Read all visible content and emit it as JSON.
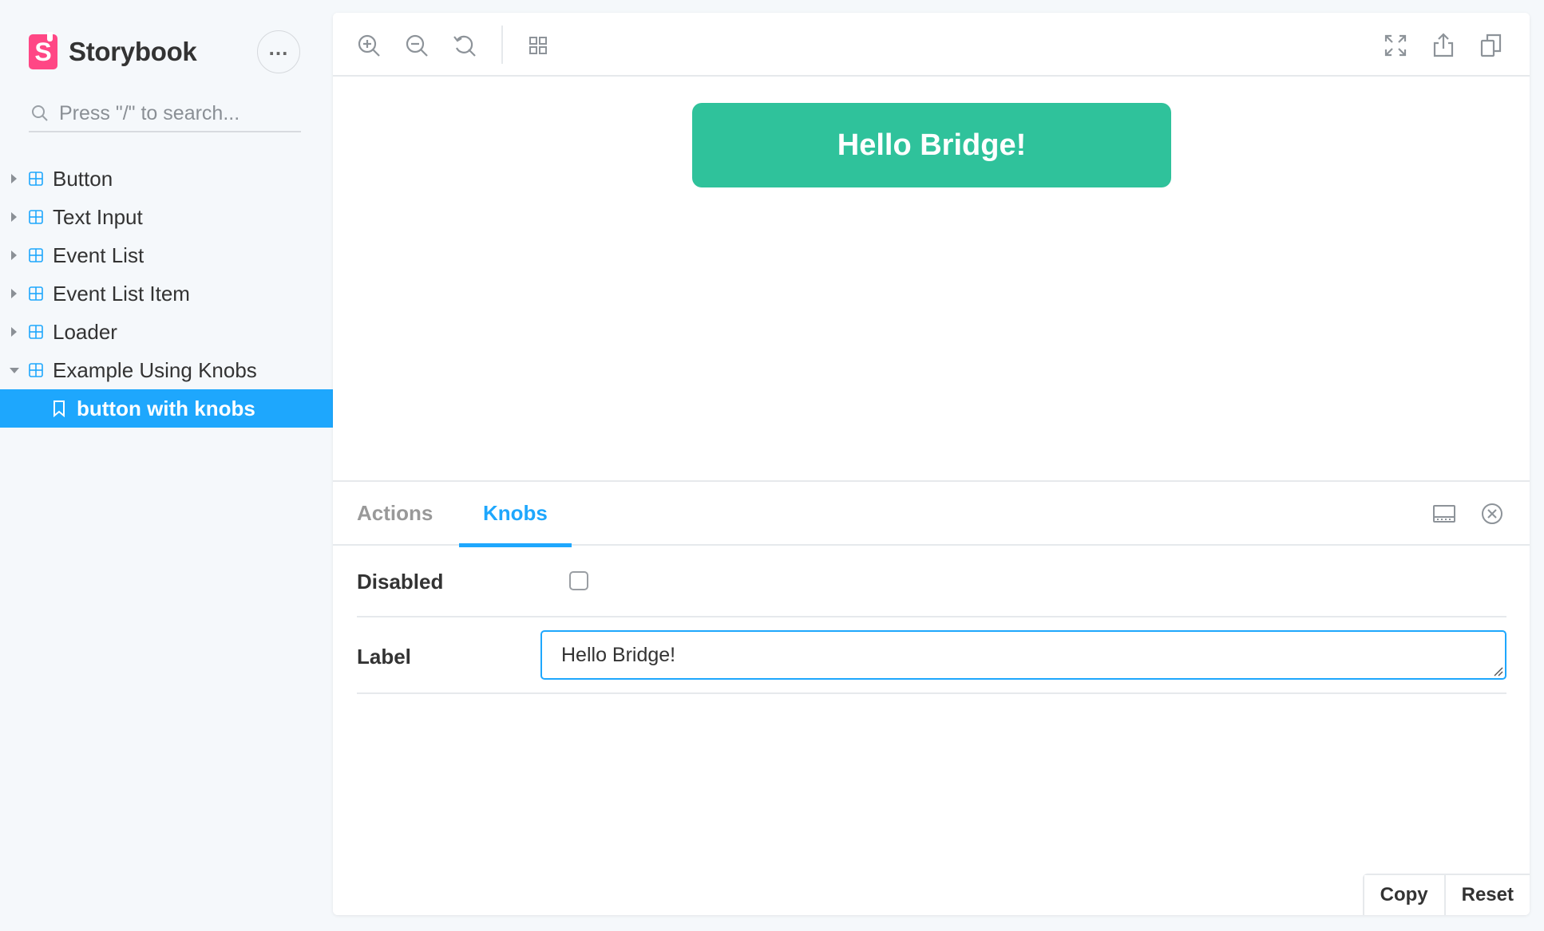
{
  "brand": {
    "logo_letter": "S",
    "name": "Storybook"
  },
  "sidebar": {
    "menu_icon": "ellipsis-icon",
    "search": {
      "placeholder": "Press \"/\" to search...",
      "value": ""
    },
    "items": [
      {
        "label": "Button",
        "expanded": false,
        "icon": "component-icon"
      },
      {
        "label": "Text Input",
        "expanded": false,
        "icon": "component-icon"
      },
      {
        "label": "Event List",
        "expanded": false,
        "icon": "component-icon"
      },
      {
        "label": "Event List Item",
        "expanded": false,
        "icon": "component-icon"
      },
      {
        "label": "Loader",
        "expanded": false,
        "icon": "component-icon"
      },
      {
        "label": "Example Using Knobs",
        "expanded": true,
        "icon": "component-icon"
      }
    ],
    "selected_story": {
      "label": "button with knobs",
      "icon": "bookmark-icon"
    }
  },
  "toolbar": {
    "left_icons": [
      "zoom-in-icon",
      "zoom-out-icon",
      "reset-zoom-icon",
      "grid-icon"
    ],
    "right_icons": [
      "fullscreen-icon",
      "share-icon",
      "copy-link-icon"
    ]
  },
  "preview": {
    "button_label": "Hello Bridge!",
    "button_color": "#2fc29b"
  },
  "addons": {
    "tabs": [
      {
        "label": "Actions",
        "active": false
      },
      {
        "label": "Knobs",
        "active": true
      }
    ],
    "panel_icons": [
      "panel-orientation-icon",
      "close-panel-icon"
    ],
    "knobs": {
      "disabled": {
        "label": "Disabled",
        "checked": false
      },
      "label": {
        "label": "Label",
        "value": "Hello Bridge!"
      }
    },
    "footer": {
      "copy_label": "Copy",
      "reset_label": "Reset"
    }
  },
  "colors": {
    "accent": "#1ea7fd",
    "brand": "#ff4785",
    "sidebar_bg": "#f5f8fb"
  }
}
